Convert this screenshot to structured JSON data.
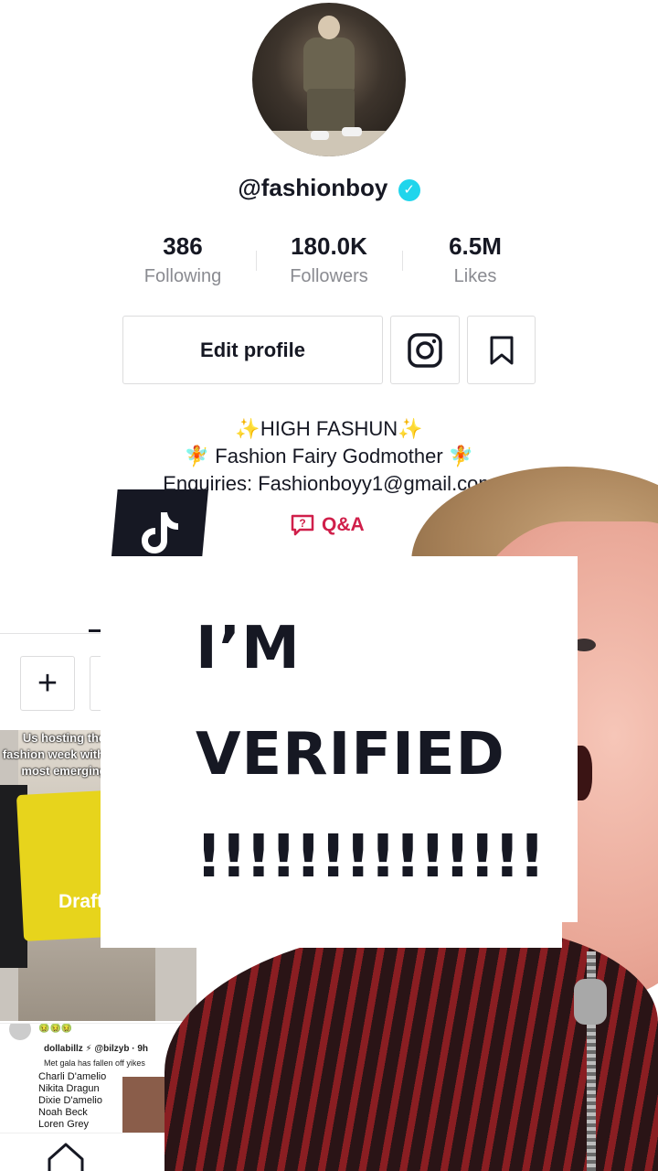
{
  "profile": {
    "username": "@fashionboy",
    "verified_icon": "verified-badge-icon"
  },
  "stats": {
    "following_value": "386",
    "following_label": "Following",
    "followers_value": "180.0K",
    "followers_label": "Followers",
    "likes_value": "6.5M",
    "likes_label": "Likes"
  },
  "actions": {
    "edit_profile_label": "Edit profile"
  },
  "bio": {
    "line1": "✨HIGH FASHUN✨",
    "line2": "🧚 Fashion Fairy Godmother 🧚",
    "line3": "Enquiries: Fashionboyy1@gmail.com"
  },
  "qa": {
    "label": "Q&A"
  },
  "thumbs": {
    "first_caption": "Us hosting the fashion week with the most emerging",
    "drafts_label": "Drafts",
    "second_emoji": "🤢🤢🤢",
    "second_user": "dollabillz ⚡ @bilzyb · 9h",
    "second_text": "Met gala has fallen off yikes",
    "second_names": [
      "Charli D'amelio",
      "Nikita Dragun",
      "Dixie D'amelio",
      "Noah Beck",
      "Loren Grey"
    ]
  },
  "overlay": {
    "line1": "I’M",
    "line2": "VERIFIED",
    "line3": "!!!!!!!!!!!!!!"
  },
  "colors": {
    "qa_accent": "#d01f4a",
    "verified": "#20d5ec",
    "text": "#161823",
    "muted": "#8a8b91"
  }
}
